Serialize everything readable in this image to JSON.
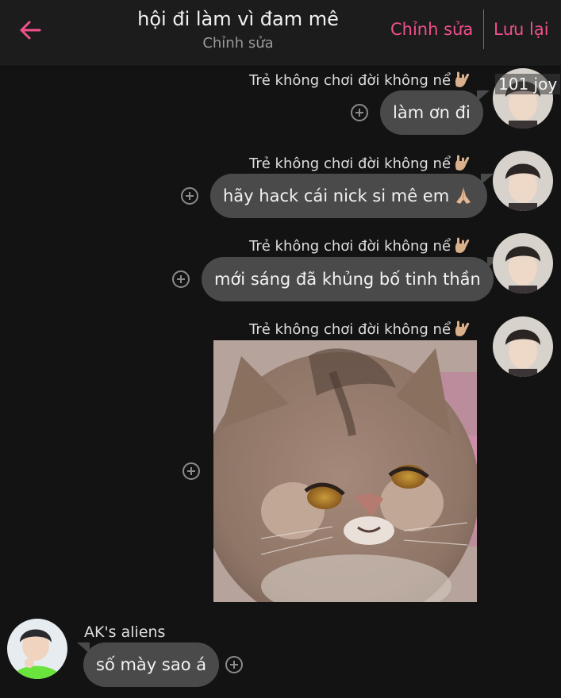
{
  "header": {
    "back_icon": "arrow-left-icon",
    "title": "hội đi làm vì đam mê",
    "subtitle": "Chỉnh sửa",
    "edit_label": "Chỉnh sửa",
    "save_label": "Lưu lại",
    "accent_color": "#f0508c"
  },
  "avatar_badge": "101 joy",
  "messages": [
    {
      "sender": "Trẻ không chơi đời không nể",
      "sender_emoji": "rock-hand-emoji",
      "text": "làm ơn đi"
    },
    {
      "sender": "Trẻ không chơi đời không nể",
      "sender_emoji": "rock-hand-emoji",
      "text": "hãy hack cái nick si mê em",
      "text_emoji": "praying-hands-emoji"
    },
    {
      "sender": "Trẻ không chơi đời không nể",
      "sender_emoji": "rock-hand-emoji",
      "text": "mới sáng đã khủng bố tinh thần"
    },
    {
      "sender": "Trẻ không chơi đời không nể",
      "sender_emoji": "rock-hand-emoji",
      "image": "grumpy-cat-photo"
    },
    {
      "sender": "AK's aliens",
      "text": "số mày sao á",
      "incoming": true
    }
  ],
  "icons": {
    "add_reaction": "plus-circle-icon"
  },
  "colors": {
    "background": "#131313",
    "header_bg": "#1c1c1c",
    "bubble": "#4a4a4a"
  }
}
